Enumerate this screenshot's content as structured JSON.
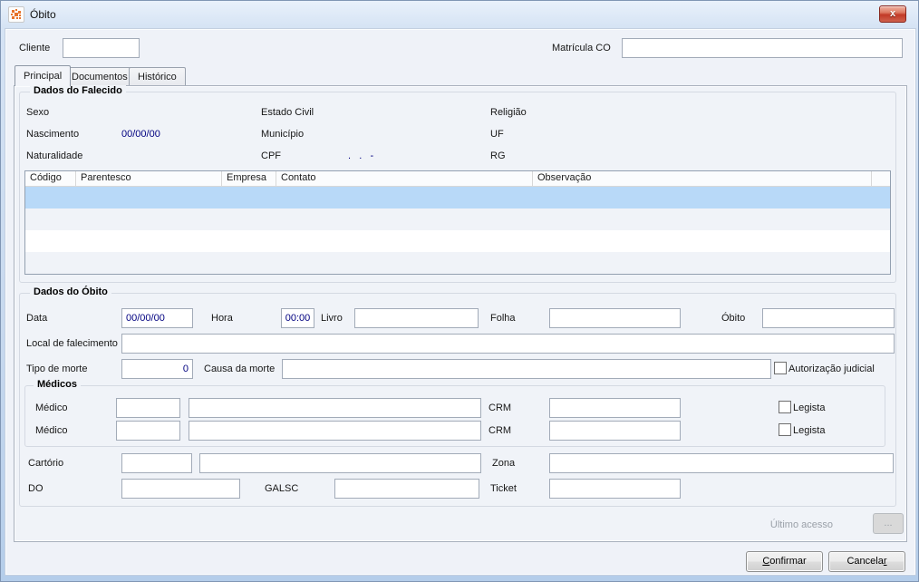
{
  "window": {
    "title": "Óbito",
    "close_glyph": "x"
  },
  "colors": {
    "selected_row": "#b8d9f8",
    "value_text": "#000080",
    "close_red": "#c23a27"
  },
  "header": {
    "cliente_label": "Cliente",
    "cliente_value": "",
    "matricula_label": "Matrícula CO",
    "matricula_value": ""
  },
  "tabs": [
    {
      "label": "Principal"
    },
    {
      "label": "Documentos"
    },
    {
      "label": "Histórico"
    }
  ],
  "falecido": {
    "legend": "Dados do Falecido",
    "sexo_label": "Sexo",
    "estado_civil_label": "Estado Civil",
    "religiao_label": "Religião",
    "nascimento_label": "Nascimento",
    "nascimento_value": "00/00/00",
    "municipio_label": "Município",
    "uf_label": "UF",
    "naturalidade_label": "Naturalidade",
    "cpf_label": "CPF",
    "cpf_value": ".   .   -",
    "rg_label": "RG",
    "table": {
      "columns": [
        "Código",
        "Parentesco",
        "Empresa",
        "Contato",
        "Observação"
      ],
      "rows": [
        [
          "",
          "",
          "",
          "",
          ""
        ],
        [
          "",
          "",
          "",
          "",
          ""
        ],
        [
          "",
          "",
          "",
          "",
          ""
        ],
        [
          "",
          "",
          "",
          "",
          ""
        ]
      ]
    }
  },
  "obito": {
    "legend": "Dados do Óbito",
    "data_label": "Data",
    "data_value": "00/00/00",
    "hora_label": "Hora",
    "hora_value": "00:00",
    "livro_label": "Livro",
    "livro_value": "",
    "folha_label": "Folha",
    "folha_value": "",
    "obito_label": "Óbito",
    "obito_value": "",
    "local_label": "Local de falecimento",
    "local_value": "",
    "tipo_label": "Tipo de morte",
    "tipo_value": "0",
    "causa_label": "Causa da morte",
    "causa_value": "",
    "autorizacao_label": "Autorização judicial",
    "medicos": {
      "legend": "Médicos",
      "medico_label": "Médico",
      "crm_label": "CRM",
      "legista_label": "Legista"
    },
    "cartorio_label": "Cartório",
    "zona_label": "Zona",
    "do_label": "DO",
    "galsc_label": "GALSC",
    "ticket_label": "Ticket"
  },
  "footer": {
    "ultimo_acesso_label": "Último acesso",
    "more_button_label": "...",
    "confirm_accel": "C",
    "confirm_rest": "onfirmar",
    "cancel_pre": "Cancela",
    "cancel_accel": "r"
  }
}
